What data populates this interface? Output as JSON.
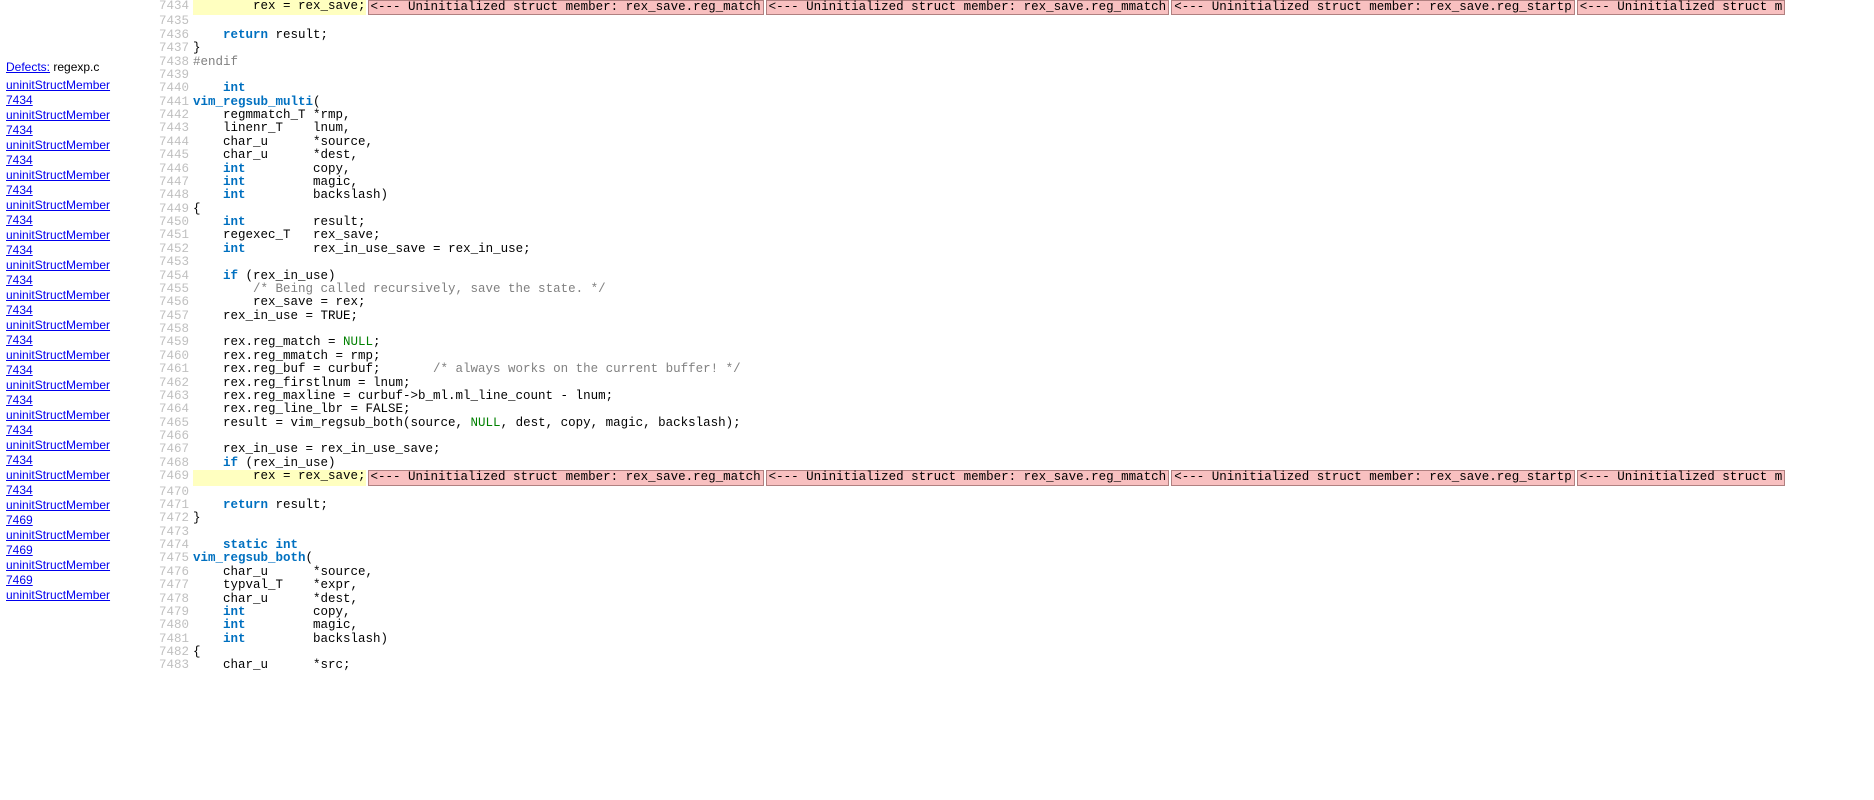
{
  "sidebar": {
    "defects_label": "Defects:",
    "filename": "regexp.c",
    "links": [
      {
        "name": "uninitStructMember",
        "line": "7434"
      },
      {
        "name": "uninitStructMember",
        "line": "7434"
      },
      {
        "name": "uninitStructMember",
        "line": "7434"
      },
      {
        "name": "uninitStructMember",
        "line": "7434"
      },
      {
        "name": "uninitStructMember",
        "line": "7434"
      },
      {
        "name": "uninitStructMember",
        "line": "7434"
      },
      {
        "name": "uninitStructMember",
        "line": "7434"
      },
      {
        "name": "uninitStructMember",
        "line": "7434"
      },
      {
        "name": "uninitStructMember",
        "line": "7434"
      },
      {
        "name": "uninitStructMember",
        "line": "7434"
      },
      {
        "name": "uninitStructMember",
        "line": "7434"
      },
      {
        "name": "uninitStructMember",
        "line": "7434"
      },
      {
        "name": "uninitStructMember",
        "line": "7434"
      },
      {
        "name": "uninitStructMember",
        "line": "7434"
      },
      {
        "name": "uninitStructMember",
        "line": "7469"
      },
      {
        "name": "uninitStructMember",
        "line": "7469"
      },
      {
        "name": "uninitStructMember",
        "line": "7469"
      },
      {
        "name": "uninitStructMember",
        "line": ""
      }
    ]
  },
  "defects": {
    "d1": "<--- Uninitialized struct member: rex_save.reg_match",
    "d2": "<--- Uninitialized struct member: rex_save.reg_mmatch",
    "d3": "<--- Uninitialized struct member: rex_save.reg_startp",
    "d4": "<--- Uninitialized struct m"
  },
  "lines": [
    {
      "n": "7434",
      "hl": true,
      "defects": true,
      "tokens": [
        {
          "t": "        rex = rex_save;",
          "c": "plain"
        }
      ]
    },
    {
      "n": "7435",
      "tokens": [
        {
          "t": "",
          "c": "plain"
        }
      ]
    },
    {
      "n": "7436",
      "tokens": [
        {
          "t": "    ",
          "c": "plain"
        },
        {
          "t": "return",
          "c": "kw"
        },
        {
          "t": " result;",
          "c": "plain"
        }
      ]
    },
    {
      "n": "7437",
      "tokens": [
        {
          "t": "}",
          "c": "plain"
        }
      ]
    },
    {
      "n": "7438",
      "tokens": [
        {
          "t": "#endif",
          "c": "pp"
        }
      ]
    },
    {
      "n": "7439",
      "tokens": [
        {
          "t": "",
          "c": "plain"
        }
      ]
    },
    {
      "n": "7440",
      "tokens": [
        {
          "t": "    ",
          "c": "plain"
        },
        {
          "t": "int",
          "c": "kw"
        }
      ]
    },
    {
      "n": "7441",
      "tokens": [
        {
          "t": "vim_regsub_multi",
          "c": "fn"
        },
        {
          "t": "(",
          "c": "plain"
        }
      ]
    },
    {
      "n": "7442",
      "tokens": [
        {
          "t": "    regmmatch_T *rmp,",
          "c": "plain"
        }
      ]
    },
    {
      "n": "7443",
      "tokens": [
        {
          "t": "    linenr_T    lnum,",
          "c": "plain"
        }
      ]
    },
    {
      "n": "7444",
      "tokens": [
        {
          "t": "    char_u      *source,",
          "c": "plain"
        }
      ]
    },
    {
      "n": "7445",
      "tokens": [
        {
          "t": "    char_u      *dest,",
          "c": "plain"
        }
      ]
    },
    {
      "n": "7446",
      "tokens": [
        {
          "t": "    ",
          "c": "plain"
        },
        {
          "t": "int",
          "c": "kw"
        },
        {
          "t": "         copy,",
          "c": "plain"
        }
      ]
    },
    {
      "n": "7447",
      "tokens": [
        {
          "t": "    ",
          "c": "plain"
        },
        {
          "t": "int",
          "c": "kw"
        },
        {
          "t": "         magic,",
          "c": "plain"
        }
      ]
    },
    {
      "n": "7448",
      "tokens": [
        {
          "t": "    ",
          "c": "plain"
        },
        {
          "t": "int",
          "c": "kw"
        },
        {
          "t": "         backslash)",
          "c": "plain"
        }
      ]
    },
    {
      "n": "7449",
      "tokens": [
        {
          "t": "{",
          "c": "plain"
        }
      ]
    },
    {
      "n": "7450",
      "tokens": [
        {
          "t": "    ",
          "c": "plain"
        },
        {
          "t": "int",
          "c": "kw"
        },
        {
          "t": "         result;",
          "c": "plain"
        }
      ]
    },
    {
      "n": "7451",
      "tokens": [
        {
          "t": "    regexec_T   rex_save;",
          "c": "plain"
        }
      ]
    },
    {
      "n": "7452",
      "tokens": [
        {
          "t": "    ",
          "c": "plain"
        },
        {
          "t": "int",
          "c": "kw"
        },
        {
          "t": "         rex_in_use_save = rex_in_use;",
          "c": "plain"
        }
      ]
    },
    {
      "n": "7453",
      "tokens": [
        {
          "t": "",
          "c": "plain"
        }
      ]
    },
    {
      "n": "7454",
      "tokens": [
        {
          "t": "    ",
          "c": "plain"
        },
        {
          "t": "if",
          "c": "kw"
        },
        {
          "t": " (rex_in_use)",
          "c": "plain"
        }
      ]
    },
    {
      "n": "7455",
      "tokens": [
        {
          "t": "        ",
          "c": "plain"
        },
        {
          "t": "/* Being called recursively, save the state. */",
          "c": "cm"
        }
      ]
    },
    {
      "n": "7456",
      "tokens": [
        {
          "t": "        rex_save = rex;",
          "c": "plain"
        }
      ]
    },
    {
      "n": "7457",
      "tokens": [
        {
          "t": "    rex_in_use = TRUE;",
          "c": "plain"
        }
      ]
    },
    {
      "n": "7458",
      "tokens": [
        {
          "t": "",
          "c": "plain"
        }
      ]
    },
    {
      "n": "7459",
      "tokens": [
        {
          "t": "    rex.reg_match = ",
          "c": "plain"
        },
        {
          "t": "NULL",
          "c": "const"
        },
        {
          "t": ";",
          "c": "plain"
        }
      ]
    },
    {
      "n": "7460",
      "tokens": [
        {
          "t": "    rex.reg_mmatch = rmp;",
          "c": "plain"
        }
      ]
    },
    {
      "n": "7461",
      "tokens": [
        {
          "t": "    rex.reg_buf = curbuf;       ",
          "c": "plain"
        },
        {
          "t": "/* always works on the current buffer! */",
          "c": "cm"
        }
      ]
    },
    {
      "n": "7462",
      "tokens": [
        {
          "t": "    rex.reg_firstlnum = lnum;",
          "c": "plain"
        }
      ]
    },
    {
      "n": "7463",
      "tokens": [
        {
          "t": "    rex.reg_maxline = curbuf->b_ml.ml_line_count - lnum;",
          "c": "plain"
        }
      ]
    },
    {
      "n": "7464",
      "tokens": [
        {
          "t": "    rex.reg_line_lbr = FALSE;",
          "c": "plain"
        }
      ]
    },
    {
      "n": "7465",
      "tokens": [
        {
          "t": "    result = vim_regsub_both(source, ",
          "c": "plain"
        },
        {
          "t": "NULL",
          "c": "const"
        },
        {
          "t": ", dest, copy, magic, backslash);",
          "c": "plain"
        }
      ]
    },
    {
      "n": "7466",
      "tokens": [
        {
          "t": "",
          "c": "plain"
        }
      ]
    },
    {
      "n": "7467",
      "tokens": [
        {
          "t": "    rex_in_use = rex_in_use_save;",
          "c": "plain"
        }
      ]
    },
    {
      "n": "7468",
      "tokens": [
        {
          "t": "    ",
          "c": "plain"
        },
        {
          "t": "if",
          "c": "kw"
        },
        {
          "t": " (rex_in_use)",
          "c": "plain"
        }
      ]
    },
    {
      "n": "7469",
      "hl": true,
      "defects": true,
      "tokens": [
        {
          "t": "        rex = rex_save;",
          "c": "plain"
        }
      ]
    },
    {
      "n": "7470",
      "tokens": [
        {
          "t": "",
          "c": "plain"
        }
      ]
    },
    {
      "n": "7471",
      "tokens": [
        {
          "t": "    ",
          "c": "plain"
        },
        {
          "t": "return",
          "c": "kw"
        },
        {
          "t": " result;",
          "c": "plain"
        }
      ]
    },
    {
      "n": "7472",
      "tokens": [
        {
          "t": "}",
          "c": "plain"
        }
      ]
    },
    {
      "n": "7473",
      "tokens": [
        {
          "t": "",
          "c": "plain"
        }
      ]
    },
    {
      "n": "7474",
      "tokens": [
        {
          "t": "    ",
          "c": "plain"
        },
        {
          "t": "static",
          "c": "kw"
        },
        {
          "t": " ",
          "c": "plain"
        },
        {
          "t": "int",
          "c": "kw"
        }
      ]
    },
    {
      "n": "7475",
      "tokens": [
        {
          "t": "vim_regsub_both",
          "c": "fn"
        },
        {
          "t": "(",
          "c": "plain"
        }
      ]
    },
    {
      "n": "7476",
      "tokens": [
        {
          "t": "    char_u      *source,",
          "c": "plain"
        }
      ]
    },
    {
      "n": "7477",
      "tokens": [
        {
          "t": "    typval_T    *expr,",
          "c": "plain"
        }
      ]
    },
    {
      "n": "7478",
      "tokens": [
        {
          "t": "    char_u      *dest,",
          "c": "plain"
        }
      ]
    },
    {
      "n": "7479",
      "tokens": [
        {
          "t": "    ",
          "c": "plain"
        },
        {
          "t": "int",
          "c": "kw"
        },
        {
          "t": "         copy,",
          "c": "plain"
        }
      ]
    },
    {
      "n": "7480",
      "tokens": [
        {
          "t": "    ",
          "c": "plain"
        },
        {
          "t": "int",
          "c": "kw"
        },
        {
          "t": "         magic,",
          "c": "plain"
        }
      ]
    },
    {
      "n": "7481",
      "tokens": [
        {
          "t": "    ",
          "c": "plain"
        },
        {
          "t": "int",
          "c": "kw"
        },
        {
          "t": "         backslash)",
          "c": "plain"
        }
      ]
    },
    {
      "n": "7482",
      "tokens": [
        {
          "t": "{",
          "c": "plain"
        }
      ]
    },
    {
      "n": "7483",
      "tokens": [
        {
          "t": "    char_u      *src;",
          "c": "plain"
        }
      ]
    }
  ]
}
